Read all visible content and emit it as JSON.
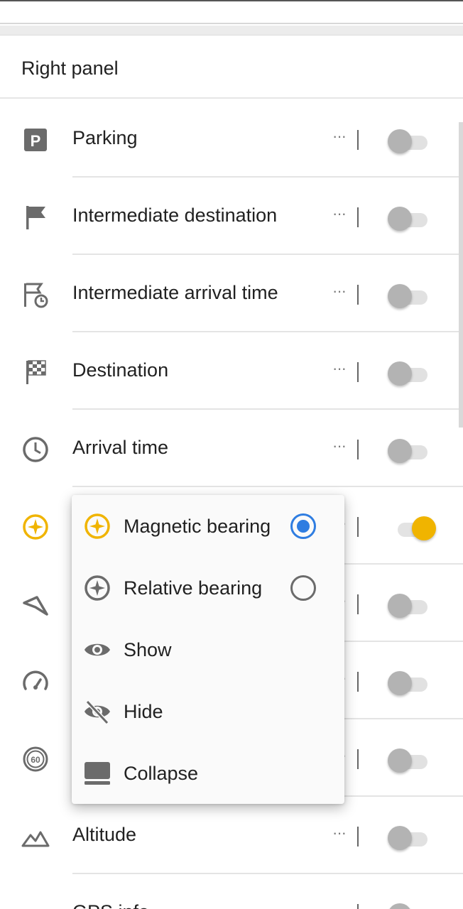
{
  "header": {
    "title": "Right panel"
  },
  "colors": {
    "accent": "#f0b400",
    "radio_selected": "#2f7de1",
    "icon_gray": "#6b6b6b"
  },
  "rows": [
    {
      "label": "Parking",
      "icon": "parking-icon",
      "enabled": false
    },
    {
      "label": "Intermediate destination",
      "icon": "flag-icon",
      "enabled": false
    },
    {
      "label": "Intermediate arrival time",
      "icon": "flag-clock-icon",
      "enabled": false
    },
    {
      "label": "Destination",
      "icon": "checkered-flag-icon",
      "enabled": false
    },
    {
      "label": "Arrival time",
      "icon": "clock-icon",
      "enabled": false
    },
    {
      "label": "",
      "icon": "magnetic-bearing-icon",
      "enabled": true
    },
    {
      "label": "",
      "icon": "navigation-arrow-icon",
      "enabled": false
    },
    {
      "label": "",
      "icon": "speedometer-icon",
      "enabled": false
    },
    {
      "label": "",
      "icon": "speed-limit-icon",
      "enabled": false
    },
    {
      "label": "Altitude",
      "icon": "altitude-icon",
      "enabled": false
    },
    {
      "label": "GPS info",
      "icon": "gps-info-icon",
      "enabled": false
    }
  ],
  "menu": {
    "items": [
      {
        "label": "Magnetic bearing",
        "icon": "magnetic-bearing-icon",
        "radio": "selected"
      },
      {
        "label": "Relative bearing",
        "icon": "relative-bearing-icon",
        "radio": "unselected"
      },
      {
        "label": "Show",
        "icon": "eye-icon"
      },
      {
        "label": "Hide",
        "icon": "eye-off-icon"
      },
      {
        "label": "Collapse",
        "icon": "collapse-icon"
      }
    ]
  },
  "more_glyph": "···"
}
